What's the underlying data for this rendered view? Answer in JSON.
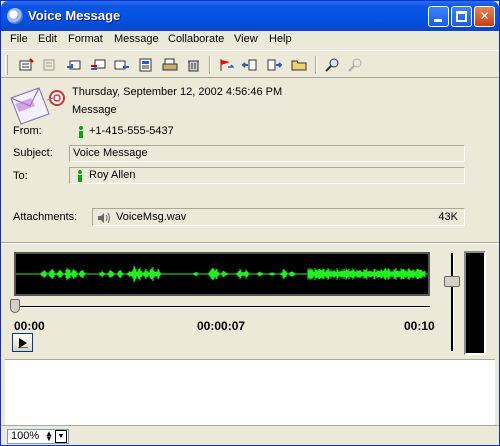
{
  "window": {
    "title": "Voice Message"
  },
  "menu": [
    "File",
    "Edit",
    "Format",
    "Message",
    "Collaborate",
    "View",
    "Help"
  ],
  "toolbar": {
    "tools": [
      "new-message-icon",
      "reply-disabled-icon",
      "reply-icon",
      "reply-all-icon",
      "forward-icon",
      "print-preview-icon",
      "print-icon",
      "delete-icon",
      "flag-icon",
      "previous-icon",
      "next-icon",
      "folder-icon",
      "find-icon",
      "find-disabled-icon"
    ]
  },
  "message": {
    "date": "Thursday, September 12, 2002 4:56:46 PM",
    "type": "Message",
    "from_label": "From:",
    "from_value": "+1-415-555-5437",
    "subject_label": "Subject:",
    "subject_value": "Voice Message",
    "to_label": "To:",
    "to_value": "Roy Allen",
    "attachments_label": "Attachments:",
    "attachment_name": "VoiceMsg.wav",
    "attachment_size": "43K"
  },
  "player": {
    "time_start": "00:00",
    "time_current": "00:00:07",
    "time_end": "00:10",
    "waveform_color": "#22ee22"
  },
  "statusbar": {
    "zoom": "100%"
  }
}
